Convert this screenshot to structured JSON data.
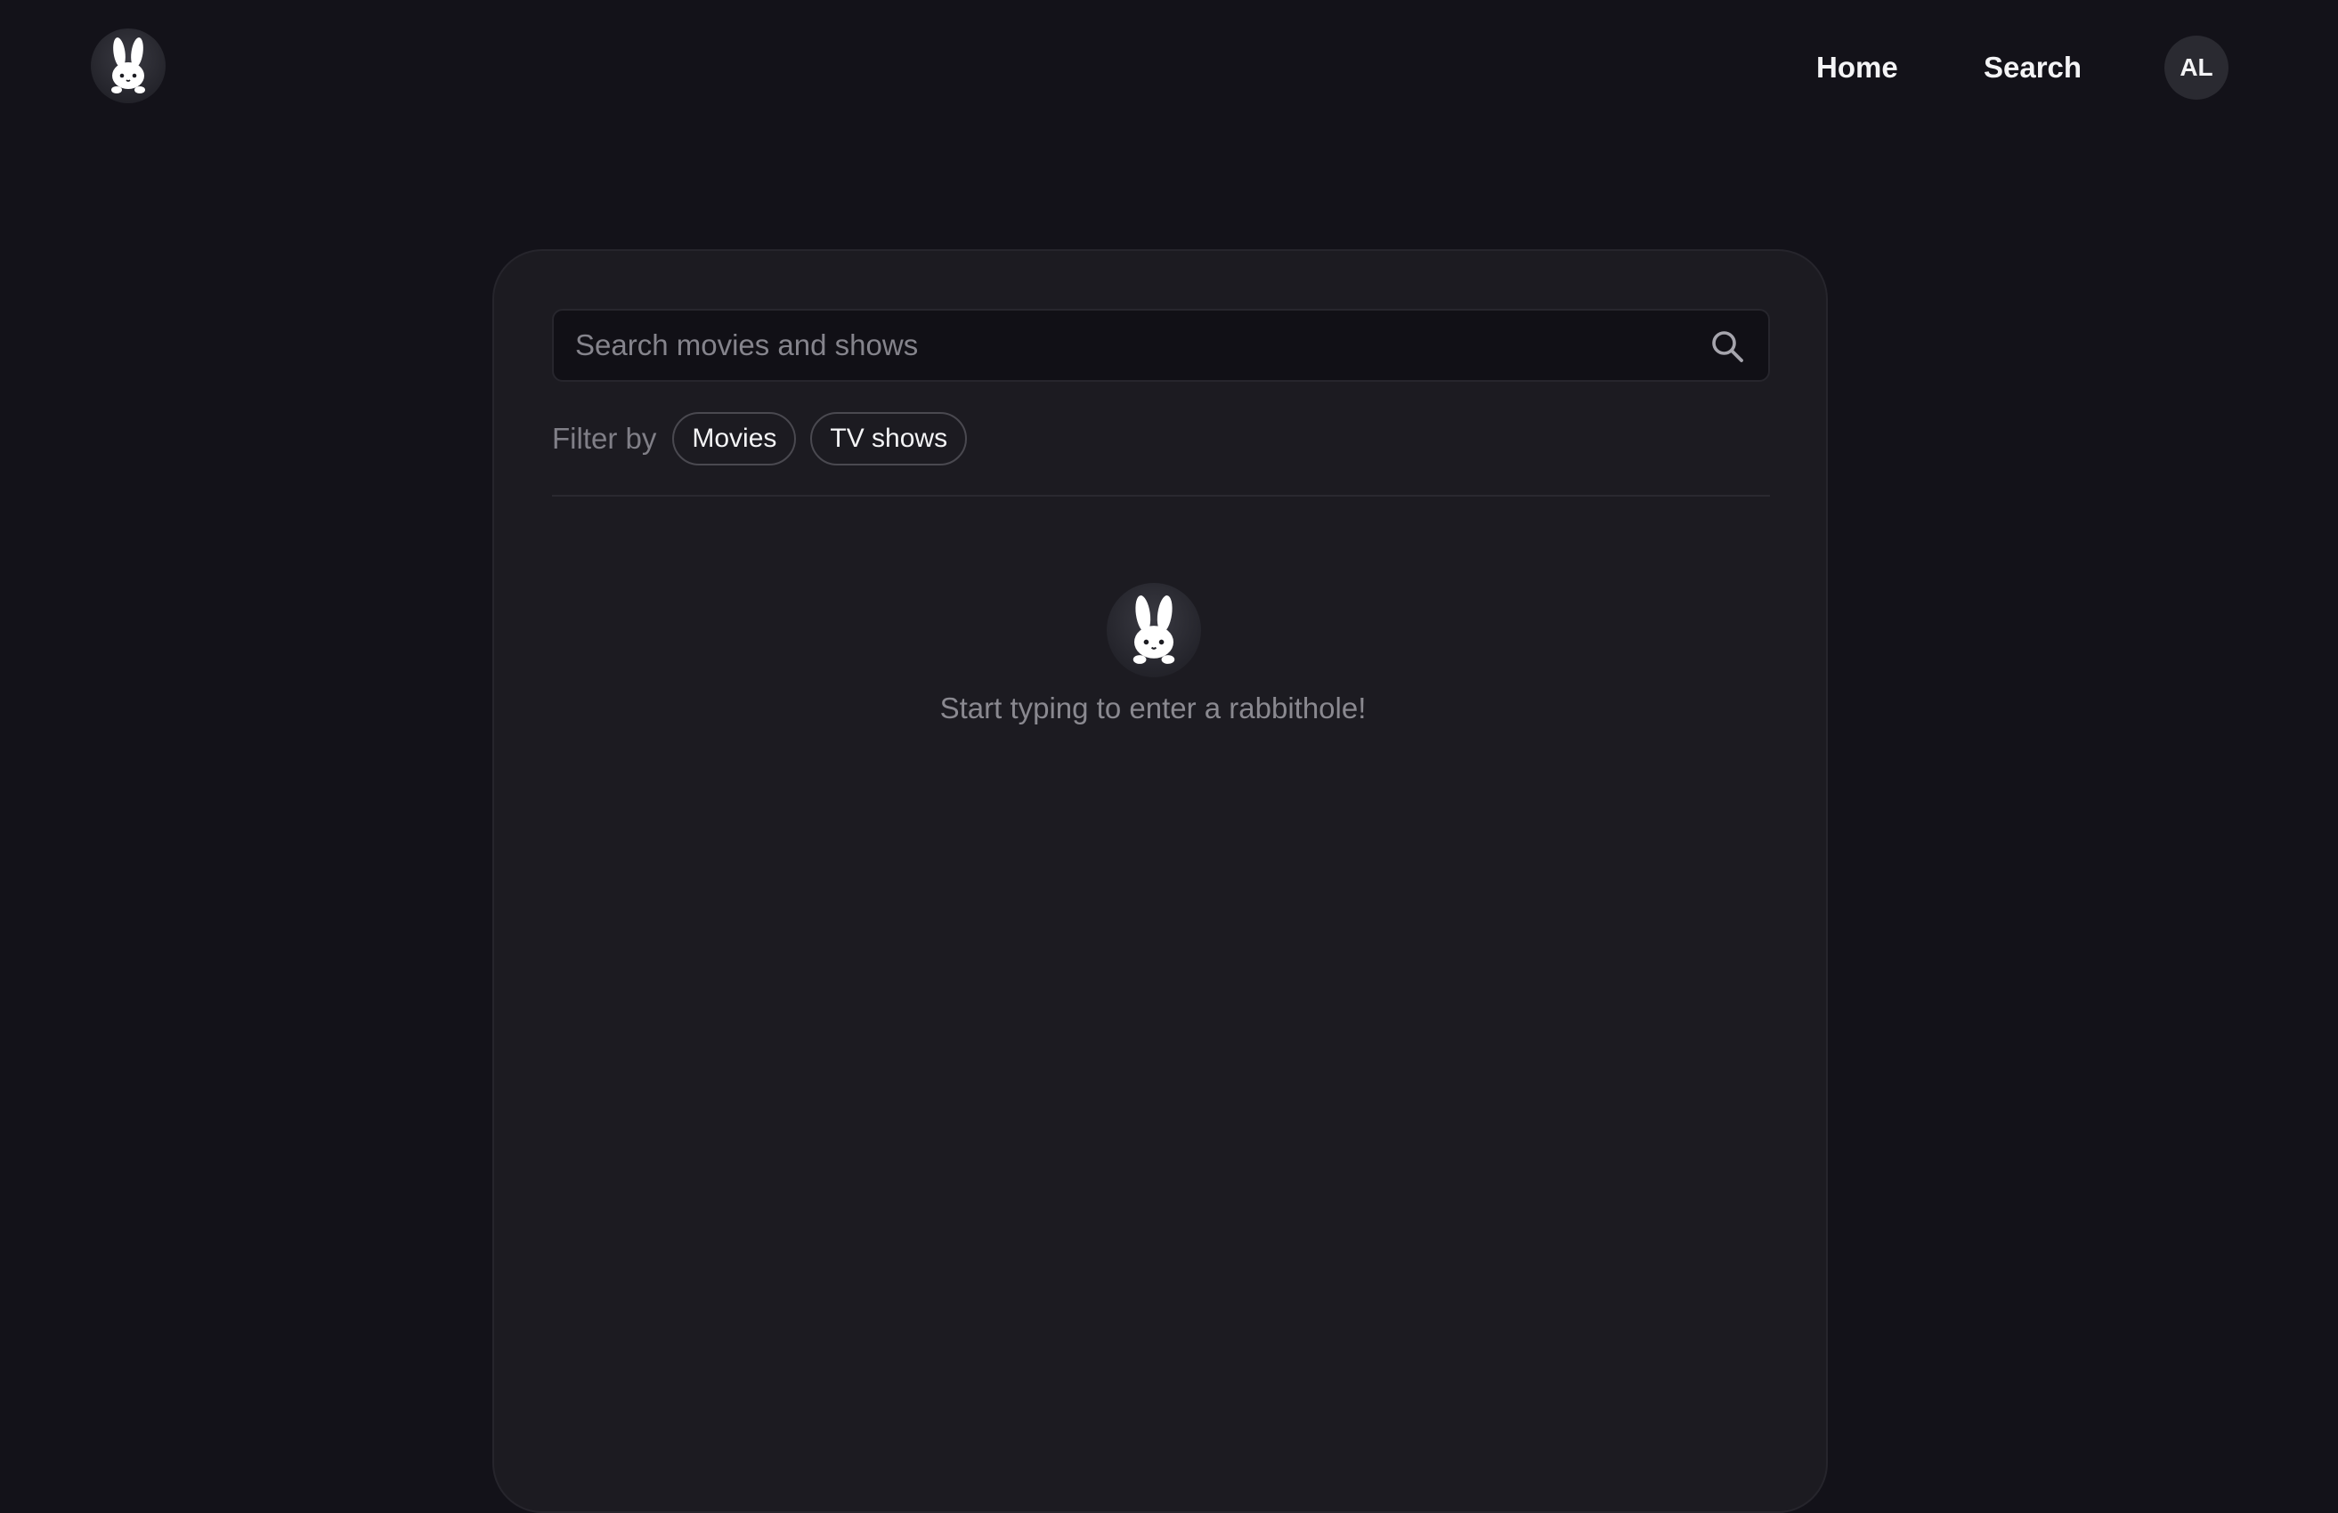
{
  "header": {
    "logo_icon": "bunny-icon",
    "nav": {
      "home_label": "Home",
      "search_label": "Search"
    },
    "avatar_initials": "AL"
  },
  "search": {
    "placeholder": "Search movies and shows",
    "value": "",
    "icon": "search-icon"
  },
  "filter": {
    "label": "Filter by",
    "chips": [
      {
        "label": "Movies"
      },
      {
        "label": "TV shows"
      }
    ]
  },
  "empty_state": {
    "icon": "bunny-icon",
    "message": "Start typing to enter a rabbithole!"
  },
  "colors": {
    "background": "#131219",
    "panel": "#1c1b21",
    "input_bg": "#111016",
    "muted_text": "#807f87"
  }
}
